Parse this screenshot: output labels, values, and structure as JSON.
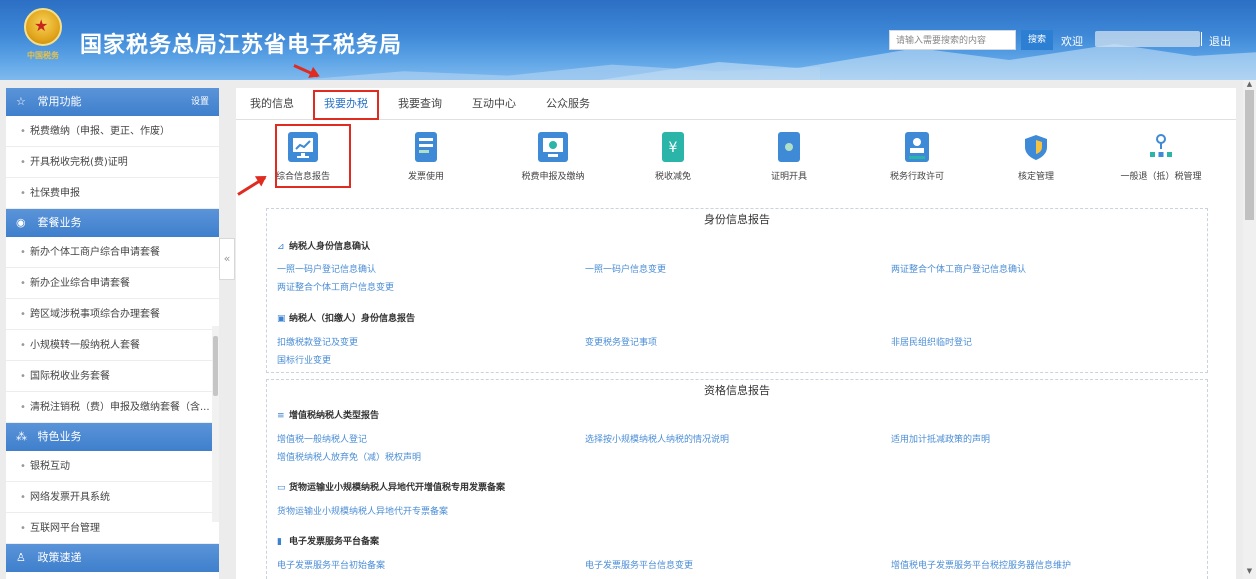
{
  "header": {
    "title": "国家税务总局江苏省电子税务局",
    "emblem_text": "中国税务",
    "search_placeholder": "请输入需要搜索的内容",
    "search_button": "搜索",
    "welcome": "欢迎",
    "logout": "退出"
  },
  "sidebar": {
    "common": {
      "title": "常用功能",
      "settings": "设置",
      "items": [
        "税费缴纳（申报、更正、作废）",
        "开具税收完税(费)证明",
        "社保费申报"
      ]
    },
    "packages": {
      "title": "套餐业务",
      "items": [
        "新办个体工商户综合申请套餐",
        "新办企业综合申请套餐",
        "跨区域涉税事项综合办理套餐",
        "小规模转一般纳税人套餐",
        "国际税收业务套餐",
        "清税注销税（费）申报及缴纳套餐（含..."
      ]
    },
    "featured": {
      "title": "特色业务",
      "items": [
        "银税互动",
        "网络发票开具系统",
        "互联网平台管理"
      ]
    },
    "policy": {
      "title": "政策速递"
    },
    "collapse_glyph": "«"
  },
  "tabs": [
    "我的信息",
    "我要办税",
    "我要查询",
    "互动中心",
    "公众服务"
  ],
  "quick_tiles": [
    {
      "label": "综合信息报告",
      "icon": "chart-monitor-icon",
      "color": "#3e8ad6"
    },
    {
      "label": "发票使用",
      "icon": "invoice-icon",
      "color": "#3e8ad6"
    },
    {
      "label": "税费申报及缴纳",
      "icon": "monitor-icon",
      "color": "#3e8ad6"
    },
    {
      "label": "税收减免",
      "icon": "tax-relief-icon",
      "color": "#2ab5a8"
    },
    {
      "label": "证明开具",
      "icon": "certificate-icon",
      "color": "#3e8ad6"
    },
    {
      "label": "税务行政许可",
      "icon": "permit-icon",
      "color": "#3e8ad6"
    },
    {
      "label": "核定管理",
      "icon": "shield-icon",
      "color": "#3e8ad6"
    },
    {
      "label": "一般退（抵）税管理",
      "icon": "network-icon",
      "color": "#3e8ad6"
    }
  ],
  "sections": [
    {
      "title": "身份信息报告",
      "groups": [
        {
          "title": "纳税人身份信息确认",
          "links": [
            "一照一码户登记信息确认",
            "一照一码户信息变更",
            "两证整合个体工商户登记信息确认",
            "两证整合个体工商户信息变更"
          ]
        },
        {
          "title": "纳税人（扣缴人）身份信息报告",
          "links": [
            "扣缴税款登记及变更",
            "变更税务登记事项",
            "非居民组织临时登记",
            "国标行业变更"
          ]
        }
      ]
    },
    {
      "title": "资格信息报告",
      "groups": [
        {
          "title": "增值税纳税人类型报告",
          "links": [
            "增值税一般纳税人登记",
            "选择按小规模纳税人纳税的情况说明",
            "适用加计抵减政策的声明",
            "增值税纳税人放弃免（减）税权声明"
          ]
        },
        {
          "title": "货物运输业小规模纳税人异地代开增值税专用发票备案",
          "links": [
            "货物运输业小规模纳税人异地代开专票备案"
          ]
        },
        {
          "title": "电子发票服务平台备案",
          "links": [
            "电子发票服务平台初始备案",
            "电子发票服务平台信息变更",
            "增值税电子发票服务平台税控服务器信息维护"
          ]
        }
      ]
    }
  ]
}
